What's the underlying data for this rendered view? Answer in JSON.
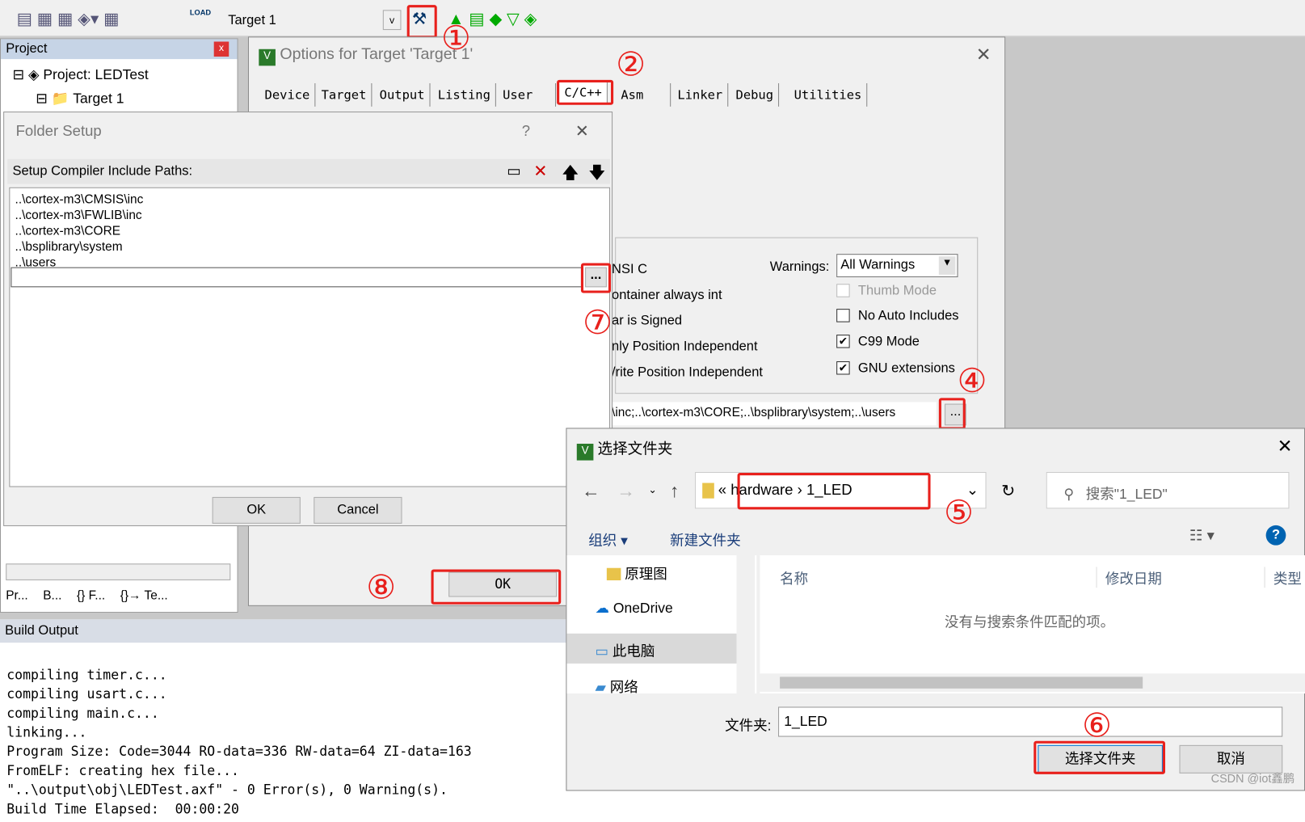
{
  "toolbar": {
    "target_select": "Target 1",
    "load_label": "LOAD"
  },
  "project": {
    "title": "Project",
    "root": "Project: LEDTest",
    "target": "Target 1",
    "bottom_tabs": [
      "Pr...",
      "B...",
      "{} F...",
      "{}→ Te..."
    ]
  },
  "options_dialog": {
    "title": "Options for Target 'Target 1'",
    "tabs": [
      "Device",
      "Target",
      "Output",
      "Listing",
      "User",
      "C/C++",
      "Asm",
      "Linker",
      "Debug",
      "Utilities"
    ],
    "active_tab": "C/C++",
    "left_options": [
      "NSI C",
      "ontainer always int",
      "ar is Signed",
      "nly Position Independent",
      "/rite Position Independent"
    ],
    "warnings_label": "Warnings:",
    "warnings_value": "All Warnings",
    "checkboxes": [
      {
        "label": "Thumb Mode",
        "checked": false,
        "disabled": true
      },
      {
        "label": "No Auto Includes",
        "checked": false
      },
      {
        "label": "C99 Mode",
        "checked": true
      },
      {
        "label": "GNU extensions",
        "checked": true
      }
    ],
    "include_paths": "\\inc;..\\cortex-m3\\CORE;..\\bsplibrary\\system;..\\users",
    "browse": "...",
    "ok": "OK"
  },
  "folder_setup": {
    "title": "Folder Setup",
    "help": "?",
    "label": "Setup Compiler Include Paths:",
    "paths": [
      "..\\cortex-m3\\CMSIS\\inc",
      "..\\cortex-m3\\FWLIB\\inc",
      "..\\cortex-m3\\CORE",
      "..\\bsplibrary\\system",
      "..\\users"
    ],
    "browse": "...",
    "ok": "OK",
    "cancel": "Cancel"
  },
  "build_output": {
    "title": "Build Output",
    "lines": [
      "compiling timer.c...",
      "compiling usart.c...",
      "compiling main.c...",
      "linking...",
      "Program Size: Code=3044 RO-data=336 RW-data=64 ZI-data=163",
      "FromELF: creating hex file...",
      "\"..\\output\\obj\\LEDTest.axf\" - 0 Error(s), 0 Warning(s).",
      "Build Time Elapsed:  00:00:20"
    ]
  },
  "folder_picker": {
    "title": "选择文件夹",
    "breadcrumb": [
      "hardware",
      "1_LED"
    ],
    "search_placeholder": "搜索\"1_LED\"",
    "organize": "组织",
    "new_folder": "新建文件夹",
    "nav": [
      "原理图",
      "OneDrive",
      "此电脑",
      "网络"
    ],
    "columns": [
      "名称",
      "修改日期",
      "类型"
    ],
    "empty": "没有与搜索条件匹配的项。",
    "folder_label": "文件夹:",
    "folder_value": "1_LED",
    "select": "选择文件夹",
    "cancel": "取消"
  },
  "annotations": [
    "①",
    "②",
    "④",
    "⑤",
    "⑥",
    "⑦",
    "⑧"
  ],
  "watermark": "CSDN @iot鑫鹏",
  "colors": {
    "highlight": "#e8201c",
    "accent": "#0063b1"
  }
}
